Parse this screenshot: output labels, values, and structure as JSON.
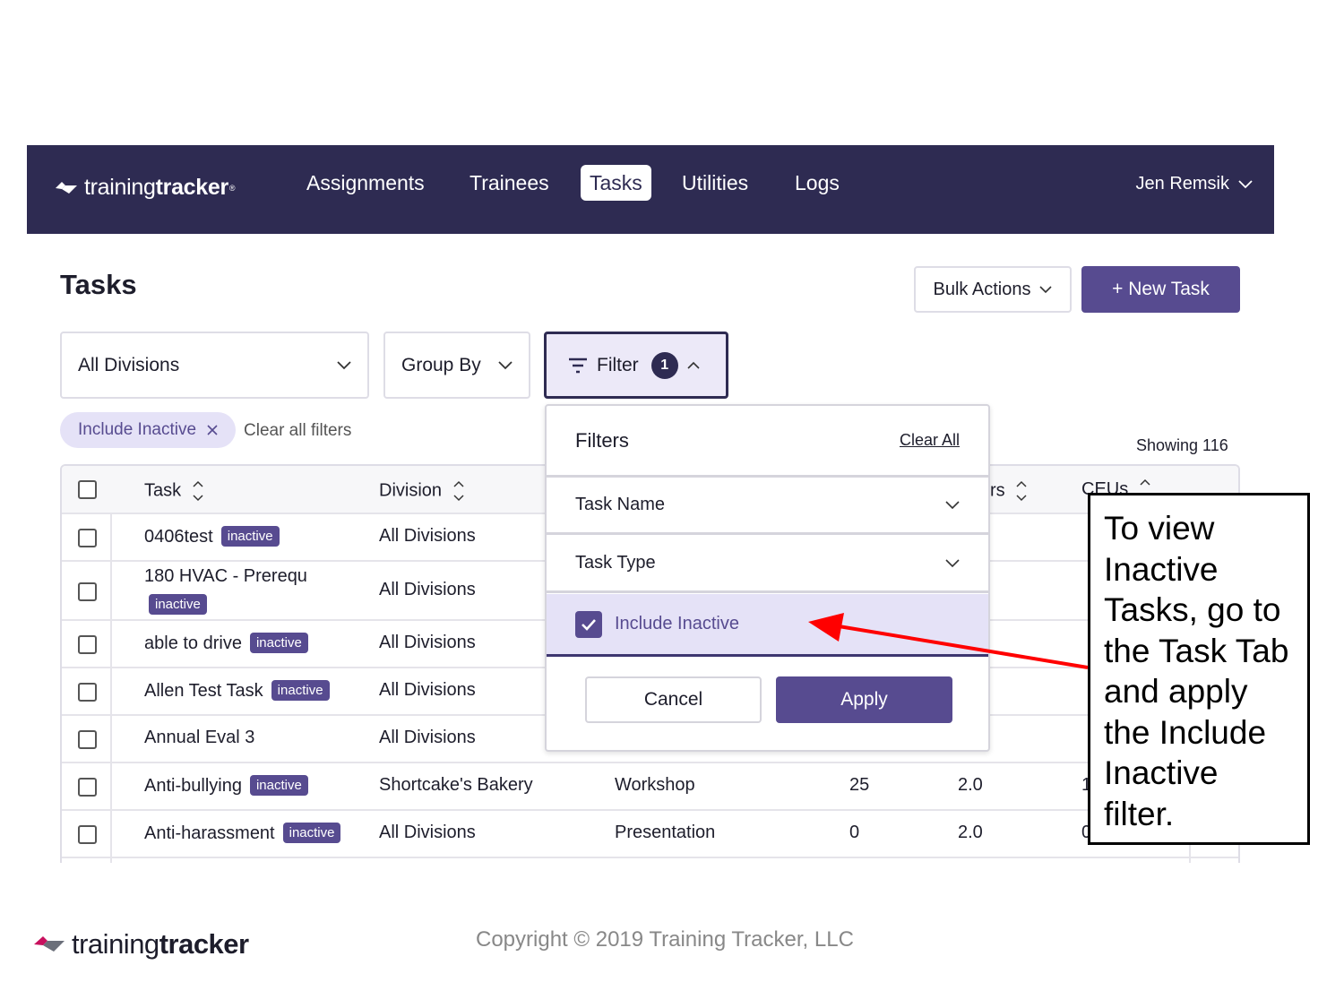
{
  "nav": {
    "brand_light": "training",
    "brand_bold": "tracker",
    "brand_mark": "®",
    "tabs": [
      {
        "label": "Assignments",
        "active": false
      },
      {
        "label": "Trainees",
        "active": false
      },
      {
        "label": "Tasks",
        "active": true
      },
      {
        "label": "Utilities",
        "active": false
      },
      {
        "label": "Logs",
        "active": false
      }
    ],
    "user_name": "Jen Remsik"
  },
  "page": {
    "title": "Tasks",
    "bulk_actions_label": "Bulk Actions",
    "new_task_label": "+ New Task"
  },
  "filters": {
    "division_select": "All Divisions",
    "group_by_select": "Group By",
    "filter_button": "Filter",
    "filter_count": "1",
    "active_chip": "Include Inactive",
    "clear_all_filters": "Clear all filters",
    "showing": "Showing 116"
  },
  "table": {
    "headers": {
      "task": "Task",
      "division": "Division",
      "hours_partial": "rs",
      "ceus": "CEUs"
    },
    "inactive_tag": "inactive",
    "rows": [
      {
        "task": "0406test",
        "division": "All Divisions"
      },
      {
        "task": "180 HVAC - Prerequ",
        "division": "All Divisions"
      },
      {
        "task": "able to drive",
        "division": "All Divisions"
      },
      {
        "task": "Allen Test Task",
        "division": "All Divisions"
      },
      {
        "task": "Annual Eval 3",
        "division": "All Divisions"
      },
      {
        "task": "Anti-bullying",
        "division": "Shortcake's Bakery",
        "type": "Workshop",
        "num": "25",
        "hours": "2.0",
        "ceus": "1"
      },
      {
        "task": "Anti-harassment",
        "division": "All Divisions",
        "type": "Presentation",
        "num": "0",
        "hours": "2.0",
        "ceus": "0"
      }
    ]
  },
  "filter_panel": {
    "title": "Filters",
    "clear_all": "Clear All",
    "task_name": "Task Name",
    "task_type": "Task Type",
    "include_inactive": "Include Inactive",
    "include_inactive_checked": true,
    "cancel": "Cancel",
    "apply": "Apply"
  },
  "annotation": {
    "lines": [
      "To view",
      "Inactive",
      "Tasks, go to",
      "the Task Tab",
      "and apply",
      "the Include",
      "Inactive",
      "filter."
    ],
    "arrow_color": "#ff0000"
  },
  "footer": {
    "logo_light": "training",
    "logo_bold": "tracker",
    "copyright": "Copyright © 2019 Training Tracker, LLC"
  },
  "colors": {
    "nav_bg": "#2e2b52",
    "accent": "#574b90",
    "chip_bg": "#e5e2f7"
  }
}
